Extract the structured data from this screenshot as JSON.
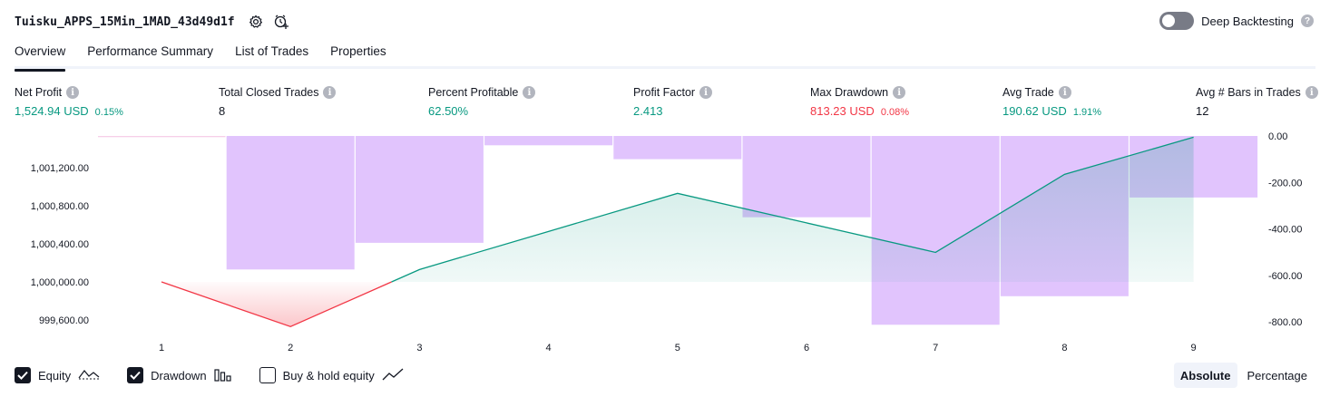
{
  "header": {
    "title": "Tuisku_APPS_15Min_1MAD_43d49d1f",
    "settings_icon": "gear-icon",
    "alert_icon": "add-alert-clock-icon"
  },
  "deep_backtesting": {
    "label": "Deep Backtesting",
    "enabled": false,
    "help": "?"
  },
  "tabs": [
    {
      "label": "Overview",
      "active": true
    },
    {
      "label": "Performance Summary",
      "active": false
    },
    {
      "label": "List of Trades",
      "active": false
    },
    {
      "label": "Properties",
      "active": false
    }
  ],
  "metrics": [
    {
      "label": "Net Profit",
      "value": "1,524.94 USD",
      "pct": "0.15%",
      "color": "#089981"
    },
    {
      "label": "Total Closed Trades",
      "value": "8",
      "pct": "",
      "color": "#131722"
    },
    {
      "label": "Percent Profitable",
      "value": "62.50%",
      "pct": "",
      "color": "#089981"
    },
    {
      "label": "Profit Factor",
      "value": "2.413",
      "pct": "",
      "color": "#089981"
    },
    {
      "label": "Max Drawdown",
      "value": "813.23 USD",
      "pct": "0.08%",
      "color": "#f23645"
    },
    {
      "label": "Avg Trade",
      "value": "190.62 USD",
      "pct": "1.91%",
      "color": "#089981"
    },
    {
      "label": "Avg # Bars in Trades",
      "value": "12",
      "pct": "",
      "color": "#131722"
    }
  ],
  "chart_data": {
    "type": "area",
    "x": [
      1,
      2,
      3,
      4,
      5,
      6,
      7,
      8,
      9
    ],
    "left_axis": {
      "ticks": [
        "1,001,200.00",
        "1,000,800.00",
        "1,000,400.00",
        "1,000,000.00",
        "999,600.00"
      ],
      "tick_values": [
        1001200,
        1000800,
        1000400,
        1000000,
        999600
      ]
    },
    "right_axis": {
      "ticks": [
        "0.00",
        "-200.00",
        "-400.00",
        "-600.00",
        "-800.00"
      ],
      "tick_values": [
        0,
        -200,
        -400,
        -600,
        -800
      ]
    },
    "series": [
      {
        "name": "Equity",
        "axis": "left",
        "values": [
          1000000,
          999530,
          1000130,
          null,
          1000930,
          null,
          1000310,
          1001130,
          1001520
        ]
      },
      {
        "name": "Drawdown",
        "axis": "right",
        "values": [
          -5,
          -575,
          -460,
          -40,
          -100,
          -350,
          -813,
          -690,
          -265
        ]
      }
    ],
    "colors": {
      "equity_up": "#089981",
      "equity_down": "#f23645",
      "drawdown": "#e1c4fd"
    }
  },
  "legend": [
    {
      "label": "Equity",
      "checked": true,
      "icon": "equity-line-icon"
    },
    {
      "label": "Drawdown",
      "checked": true,
      "icon": "drawdown-bars-icon"
    },
    {
      "label": "Buy & hold equity",
      "checked": false,
      "icon": "buy-hold-line-icon"
    }
  ],
  "modes": [
    {
      "label": "Absolute",
      "active": true
    },
    {
      "label": "Percentage",
      "active": false
    }
  ]
}
